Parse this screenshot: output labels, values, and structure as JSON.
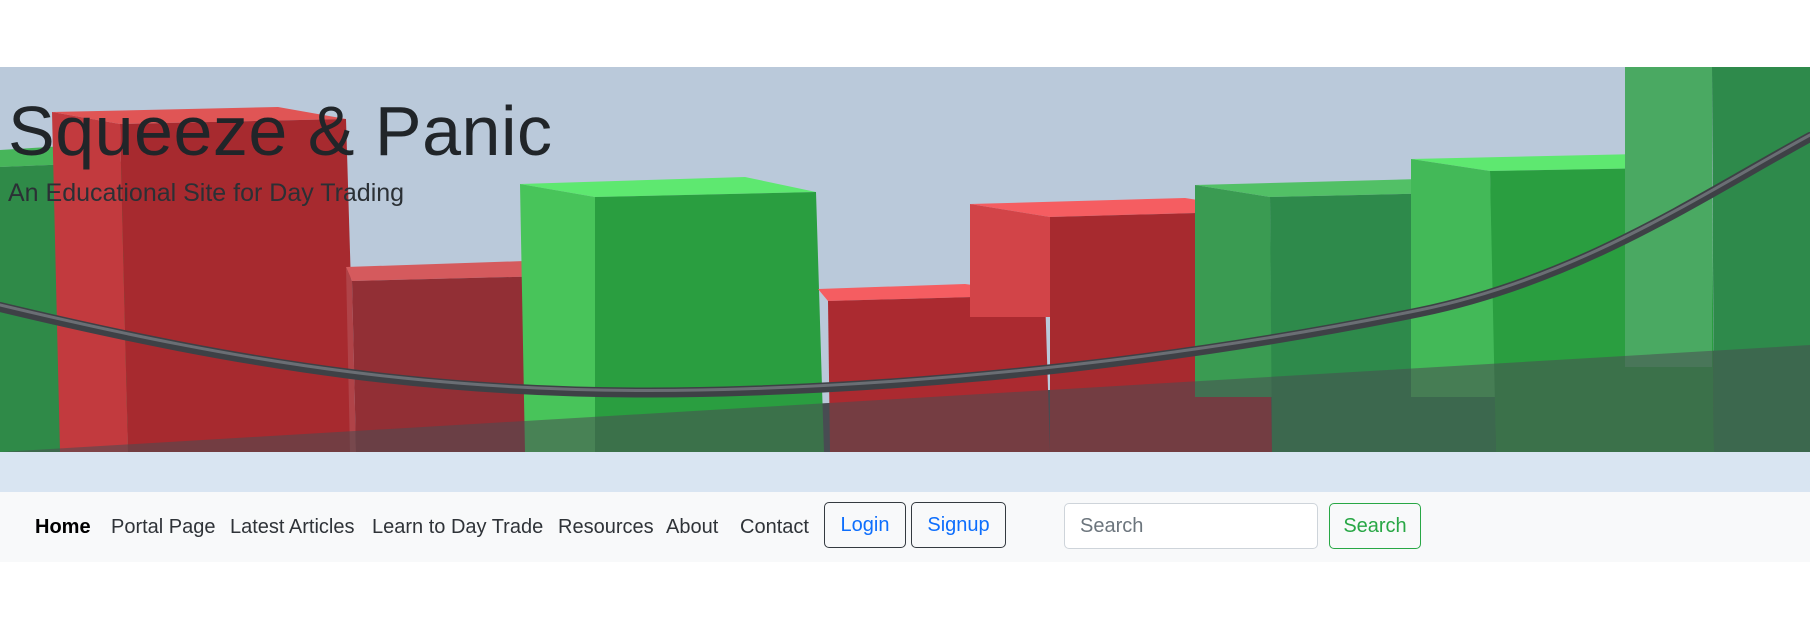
{
  "hero": {
    "title": "Squeeze & Panic",
    "subtitle": "An Educational Site for Day Trading",
    "image": "3d-candlestick-chart-banner"
  },
  "nav": {
    "links": [
      {
        "label": "Home",
        "active": true
      },
      {
        "label": "Portal Page"
      },
      {
        "label": "Latest Articles"
      },
      {
        "label": "Learn to Day Trade"
      },
      {
        "label": "Resources"
      },
      {
        "label": "About"
      },
      {
        "label": "Contact"
      }
    ],
    "login_label": "Login",
    "signup_label": "Signup",
    "search_placeholder": "Search",
    "search_button_label": "Search"
  },
  "colors": {
    "accent_blue": "#0d6efd",
    "success_green": "#28a745",
    "candle_green": "#2a9e40",
    "candle_red": "#a72a2f",
    "hero_sky": "#bac9da"
  }
}
